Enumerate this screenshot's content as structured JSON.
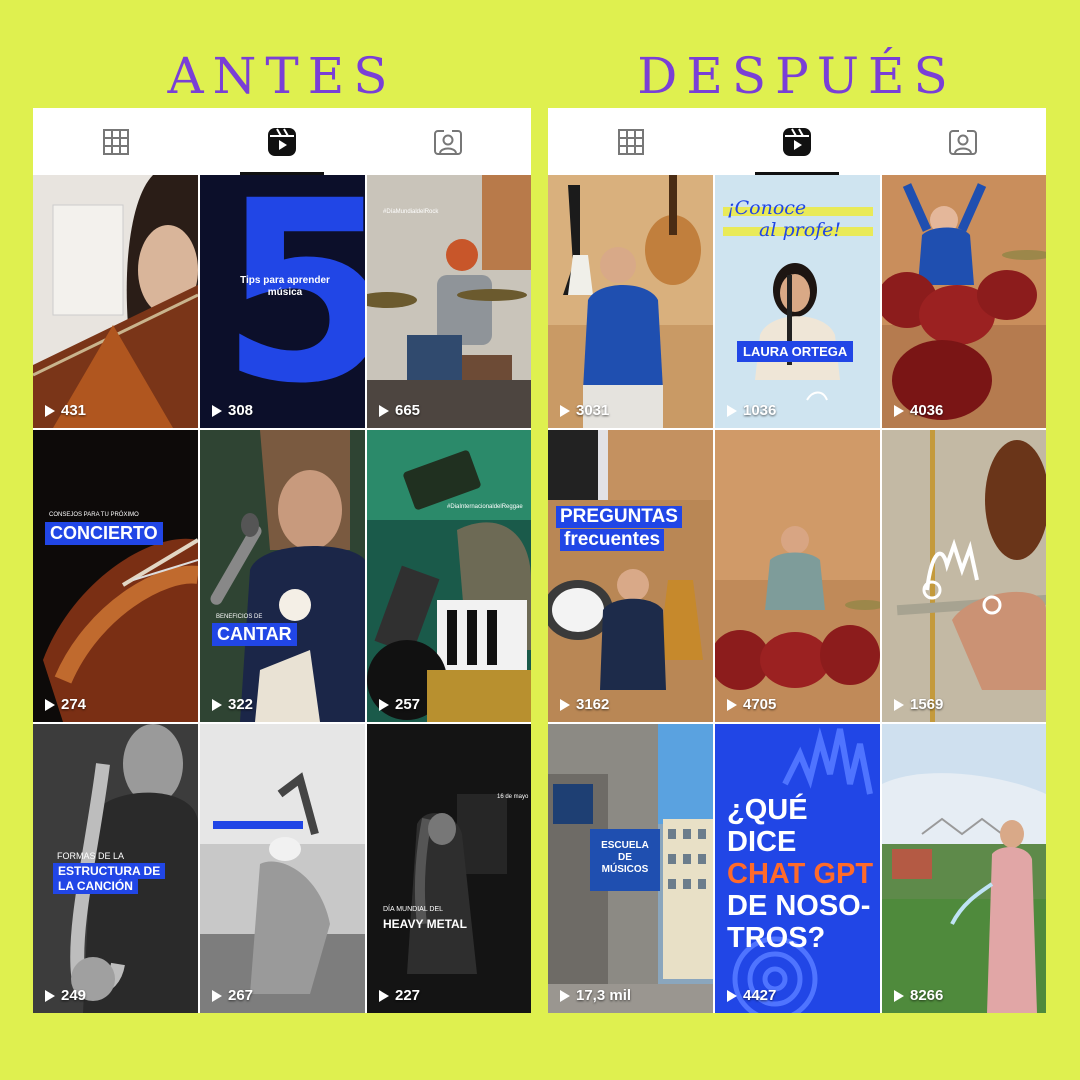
{
  "headings": {
    "before": "ANTES",
    "after": "DESPUÉS"
  },
  "colors": {
    "background": "#dff04f",
    "heading": "#7a3fd6",
    "accent_blue": "#2146e6",
    "accent_orange": "#ff6a2a"
  },
  "tab_icons": [
    "grid-icon",
    "reels-icon",
    "tagged-icon"
  ],
  "before": {
    "tiles": [
      {
        "views": "431"
      },
      {
        "views": "308",
        "big_number": "5",
        "caption": "Tips para aprender música"
      },
      {
        "views": "665",
        "hashtag": "#DíaMundialdelRock"
      },
      {
        "views": "274",
        "small": "CONSEJOS PARA TU PRÓXIMO",
        "title": "CONCIERTO"
      },
      {
        "views": "322",
        "small": "BENEFICIOS DE",
        "title": "CANTAR"
      },
      {
        "views": "257",
        "hashtag": "#DiaInternacionaldelReggae"
      },
      {
        "views": "249",
        "small": "FORMAS DE LA",
        "title_line1": "ESTRUCTURA DE",
        "title_line2": "LA CANCIÓN"
      },
      {
        "views": "267"
      },
      {
        "views": "227",
        "date": "16 de mayo",
        "small": "DÍA MUNDIAL DEL",
        "title": "HEAVY METAL"
      }
    ]
  },
  "after": {
    "tiles": [
      {
        "views": "3031"
      },
      {
        "views": "1036",
        "script_line1": "¡Conoce",
        "script_line2": "al profe!",
        "name": "LAURA ORTEGA"
      },
      {
        "views": "4036"
      },
      {
        "views": "3162",
        "title_line1": "PREGUNTAS",
        "title_line2": "frecuentes"
      },
      {
        "views": "4705"
      },
      {
        "views": "1569"
      },
      {
        "views": "17,3 mil",
        "sign_line1": "ESCUELA",
        "sign_line2": "DE",
        "sign_line3": "MÚSICOS"
      },
      {
        "views": "4427",
        "line1": "¿QUÉ",
        "line2": "DICE",
        "line3": "CHAT GPT",
        "line4": "DE NOSO-",
        "line5": "TROS?"
      },
      {
        "views": "8266"
      }
    ]
  }
}
